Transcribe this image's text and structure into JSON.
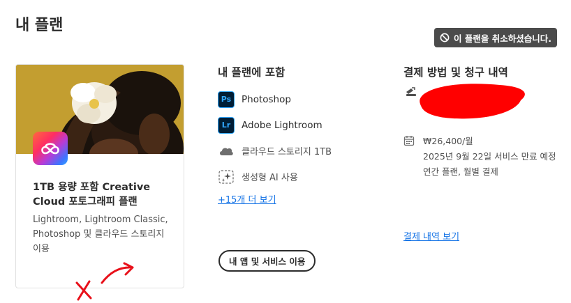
{
  "page": {
    "title": "내 플랜"
  },
  "status_badge": {
    "label": "이 플랜을 취소하셨습니다.",
    "icon": "prohibited-icon"
  },
  "plan_card": {
    "name": "1TB 용량 포함 Creative Cloud 포토그래피 플랜",
    "description": "Lightroom, Lightroom Classic, Photoshop 및 클라우드 스토리지 이용",
    "logo": "creative-cloud-icon"
  },
  "includes": {
    "heading": "내 플랜에 포함",
    "items": [
      {
        "icon_text": "Ps",
        "label": "Photoshop"
      },
      {
        "icon_text": "Lr",
        "label": "Adobe Lightroom"
      },
      {
        "icon": "cloud-icon",
        "label": "클라우드 스토리지 1TB"
      },
      {
        "icon": "sparkle-icon",
        "label": "생성형 AI 사용"
      }
    ],
    "more_link": "+15개 더 보기"
  },
  "apps_button": {
    "label": "내 앱 및 서비스 이용"
  },
  "billing": {
    "heading": "결제 방법 및 청구 내역",
    "price": "₩26,400/월",
    "service_end": "2025년 9월 22일 서비스 만료 예정",
    "plan_type": "연간 플랜, 월별 결제",
    "history_link": "결제 내역 보기"
  },
  "colors": {
    "link": "#1473e6",
    "badge_bg": "#4b4b4b",
    "app_tile_bg": "#001e36",
    "app_tile_accent": "#31a8ff",
    "redaction": "#ff0000"
  }
}
